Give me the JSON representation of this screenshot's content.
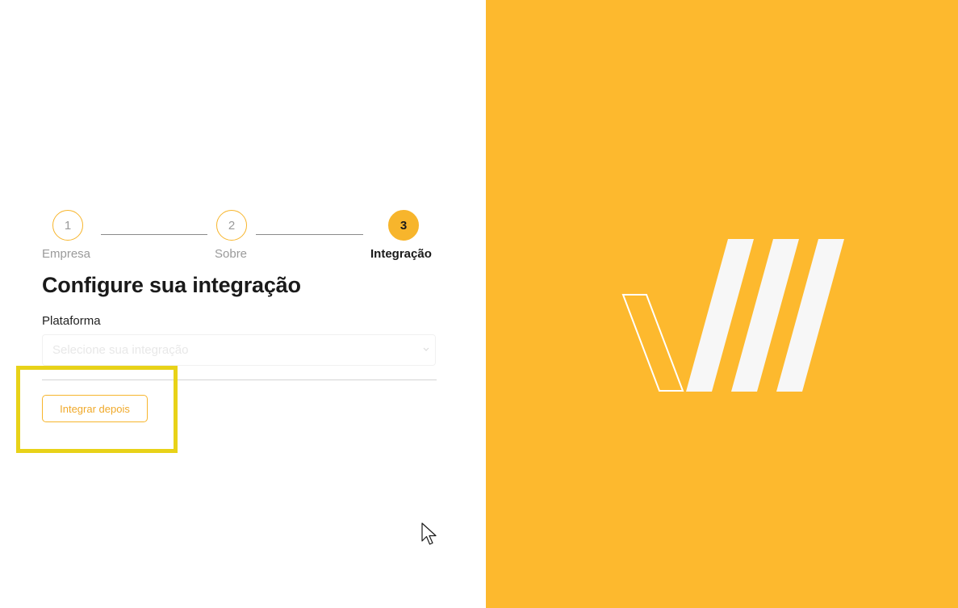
{
  "stepper": {
    "steps": [
      {
        "number": "1",
        "label": "Empresa",
        "state": "done"
      },
      {
        "number": "2",
        "label": "Sobre",
        "state": "done"
      },
      {
        "number": "3",
        "label": "Integração",
        "state": "active"
      }
    ]
  },
  "form": {
    "title": "Configure sua integração",
    "platform_label": "Plataforma",
    "platform_placeholder": "Selecione sua integração",
    "later_button_label": "Integrar depois"
  },
  "colors": {
    "accent": "#f7b52c",
    "brand_panel": "#fdb92e",
    "highlight": "#e8d218"
  },
  "icons": {
    "select_chevron": "chevron-down-icon",
    "logo": "brand-logo-icon",
    "cursor": "mouse-pointer-icon"
  }
}
